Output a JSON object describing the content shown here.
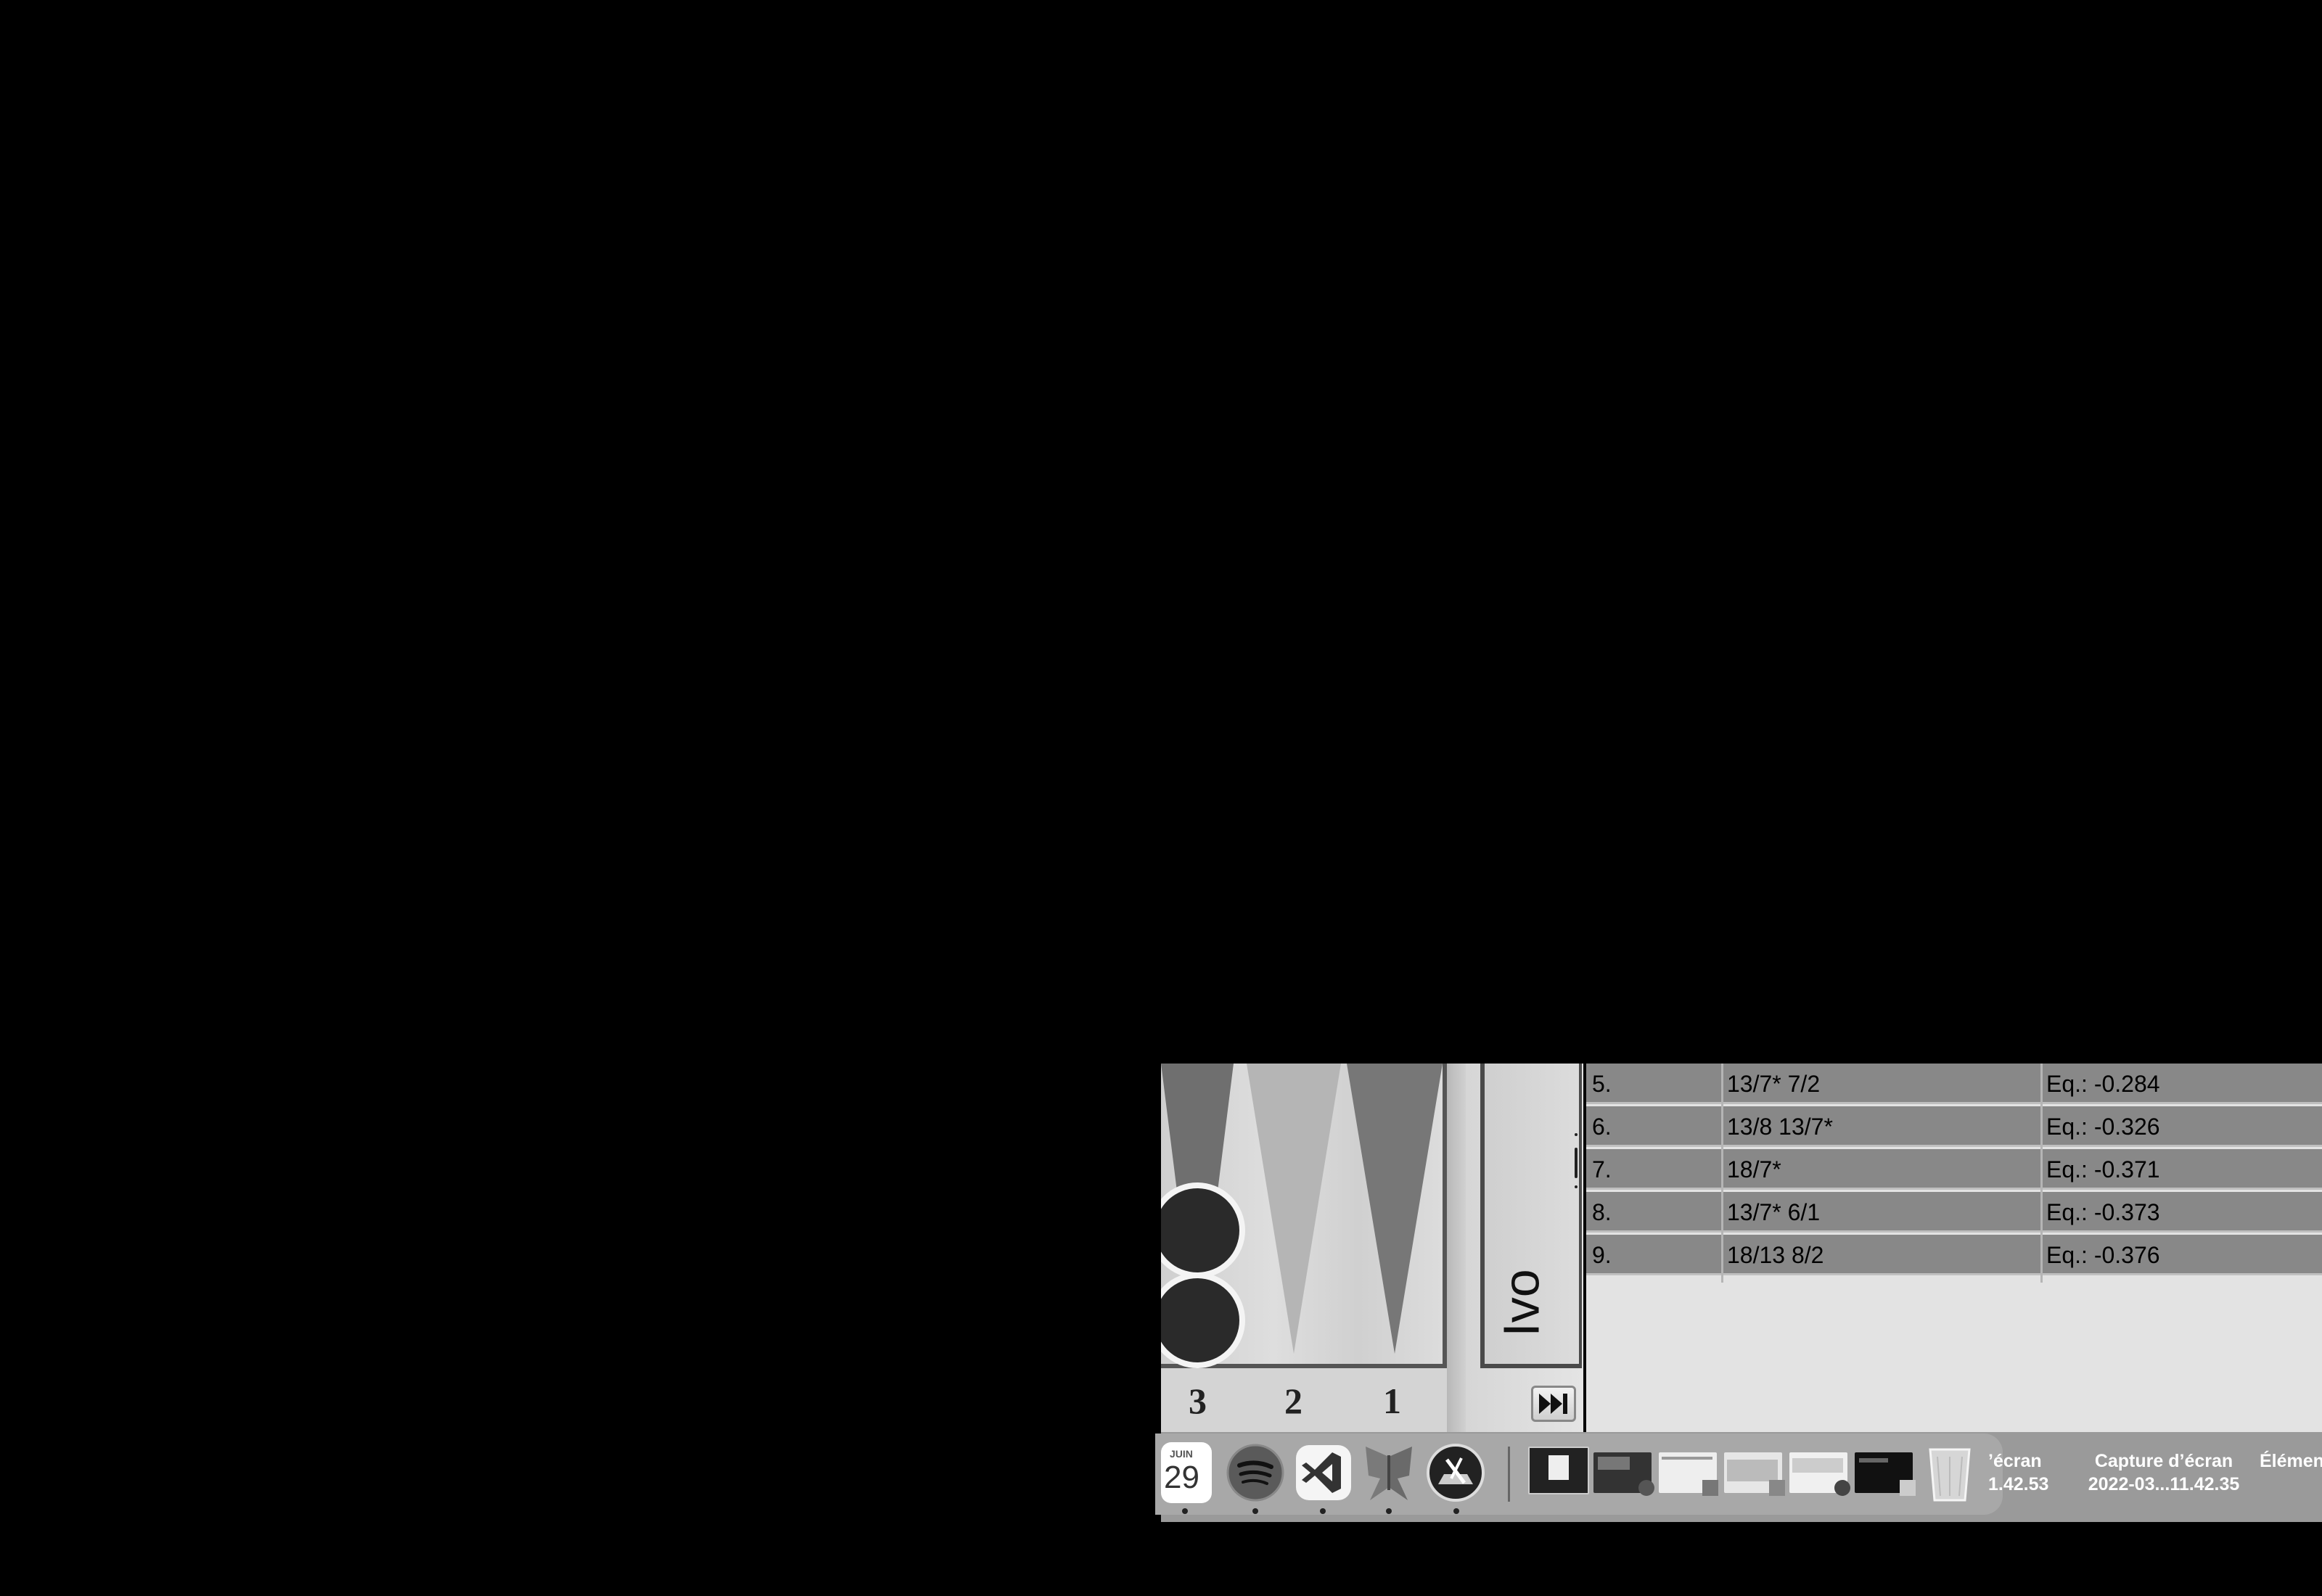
{
  "player": {
    "name": "Ivo"
  },
  "board": {
    "point_numbers": [
      "3",
      "2",
      "1"
    ]
  },
  "moves": [
    {
      "num": "5.",
      "move": "13/7* 7/2",
      "equity": "Eq.: -0.284"
    },
    {
      "num": "6.",
      "move": "13/8 13/7*",
      "equity": "Eq.: -0.326"
    },
    {
      "num": "7.",
      "move": "18/7*",
      "equity": "Eq.: -0.371"
    },
    {
      "num": "8.",
      "move": "13/7* 6/1",
      "equity": "Eq.: -0.373"
    },
    {
      "num": "9.",
      "move": "18/13 8/2",
      "equity": "Eq.: -0.376"
    }
  ],
  "dock": {
    "calendar": {
      "month": "JUIN",
      "day": "29"
    },
    "apps": [
      "calendar-icon",
      "spotify-icon",
      "vscode-icon",
      "butterfly-app-icon",
      "xcode-icon"
    ],
    "thumbnails": [
      "thumbnail-1",
      "thumbnail-2",
      "thumbnail-3",
      "thumbnail-4",
      "thumbnail-5",
      "thumbnail-6"
    ],
    "trash": "trash-icon"
  },
  "desktop_files": [
    {
      "line1": "’écran",
      "line2": "1.42.53"
    },
    {
      "line1": "Capture d’écran",
      "line2": "2022-03...11.42.35"
    },
    {
      "line1": "Élémen",
      "line2": ""
    }
  ],
  "colors": {
    "background": "#000000",
    "row": "#888888",
    "dock": "#a8a8a8"
  }
}
